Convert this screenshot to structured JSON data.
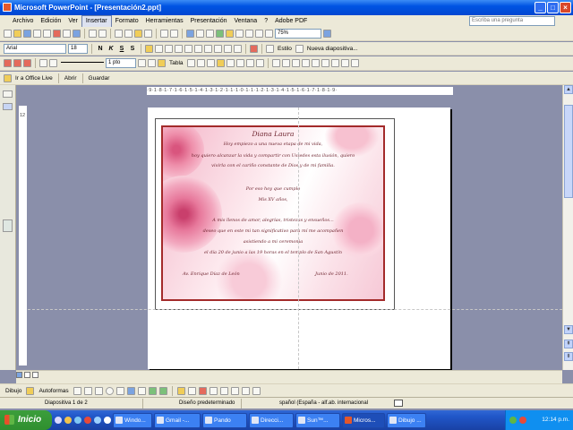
{
  "window": {
    "title": "Microsoft PowerPoint - [Presentación2.ppt]"
  },
  "menubar": {
    "items": [
      "Archivo",
      "Edición",
      "Ver",
      "Insertar",
      "Formato",
      "Herramientas",
      "Presentación",
      "Ventana",
      "?",
      "Adobe PDF"
    ],
    "active_index": 3,
    "help_placeholder": "Escriba una pregunta"
  },
  "standard_toolbar": {
    "zoom": "75%"
  },
  "formatting_toolbar": {
    "font": "Arial",
    "font_size": "18",
    "bold": "N",
    "italic": "K",
    "underline": "S",
    "shadow": "S",
    "design_label": "Estilo",
    "new_slide_label": "Nueva diapositiva..."
  },
  "picture_toolbar": {
    "line_weight": "1 pto",
    "table_label": "Tabla"
  },
  "web_toolbar": {
    "office_live": "Ir a Office Live",
    "open_label": "Abrir",
    "save_label": "Guardar"
  },
  "ruler": {
    "horizontal_text": "·9·1·8·1·7·1·6·1·5·1·4·1·3·1·2·1·1·1·0·1·1·1·2·1·3·1·4·1·5·1·6·1·7·1·8·1·9·",
    "vertical_label": "12"
  },
  "slide": {
    "heading": "Diana Laura",
    "lines": [
      "Hoy empiezo a una nueva etapa de mi vida,",
      "hoy quiero alcanzar la vida y compartir con Ustedes esta ilusión, quiero",
      "vivirla con el cariño constante de Dios y de mi familia.",
      "Por eso hoy que cumplo",
      "Mis XV años,",
      "A mis llenos de amor, alegrías, tristezas y ensueños...",
      "deseo que en este mi tan significativo para mí me acompañen",
      "asistiendo a mi ceremonia",
      "el día 20 de junio a las 19 horas en el templo de San Agustín"
    ],
    "place": "Av. Enrique Díaz de León",
    "date": "Junio de 2011."
  },
  "drawing_toolbar": {
    "draw_label": "Dibujo",
    "autoshapes_label": "Autoformas"
  },
  "statusbar": {
    "slide_info": "Diapositiva 1 de 2",
    "design": "Diseño predeterminado",
    "language": "spañol (España - alf.ab. internacional"
  },
  "taskbar": {
    "start_label": "Inicio",
    "items": [
      "Windo...",
      "Gmail -...",
      "Pando",
      "Direcci...",
      "Sun™...",
      "Micros...",
      "Dibujo ..."
    ],
    "active_index": 5,
    "clock": "12:14 p.m."
  }
}
